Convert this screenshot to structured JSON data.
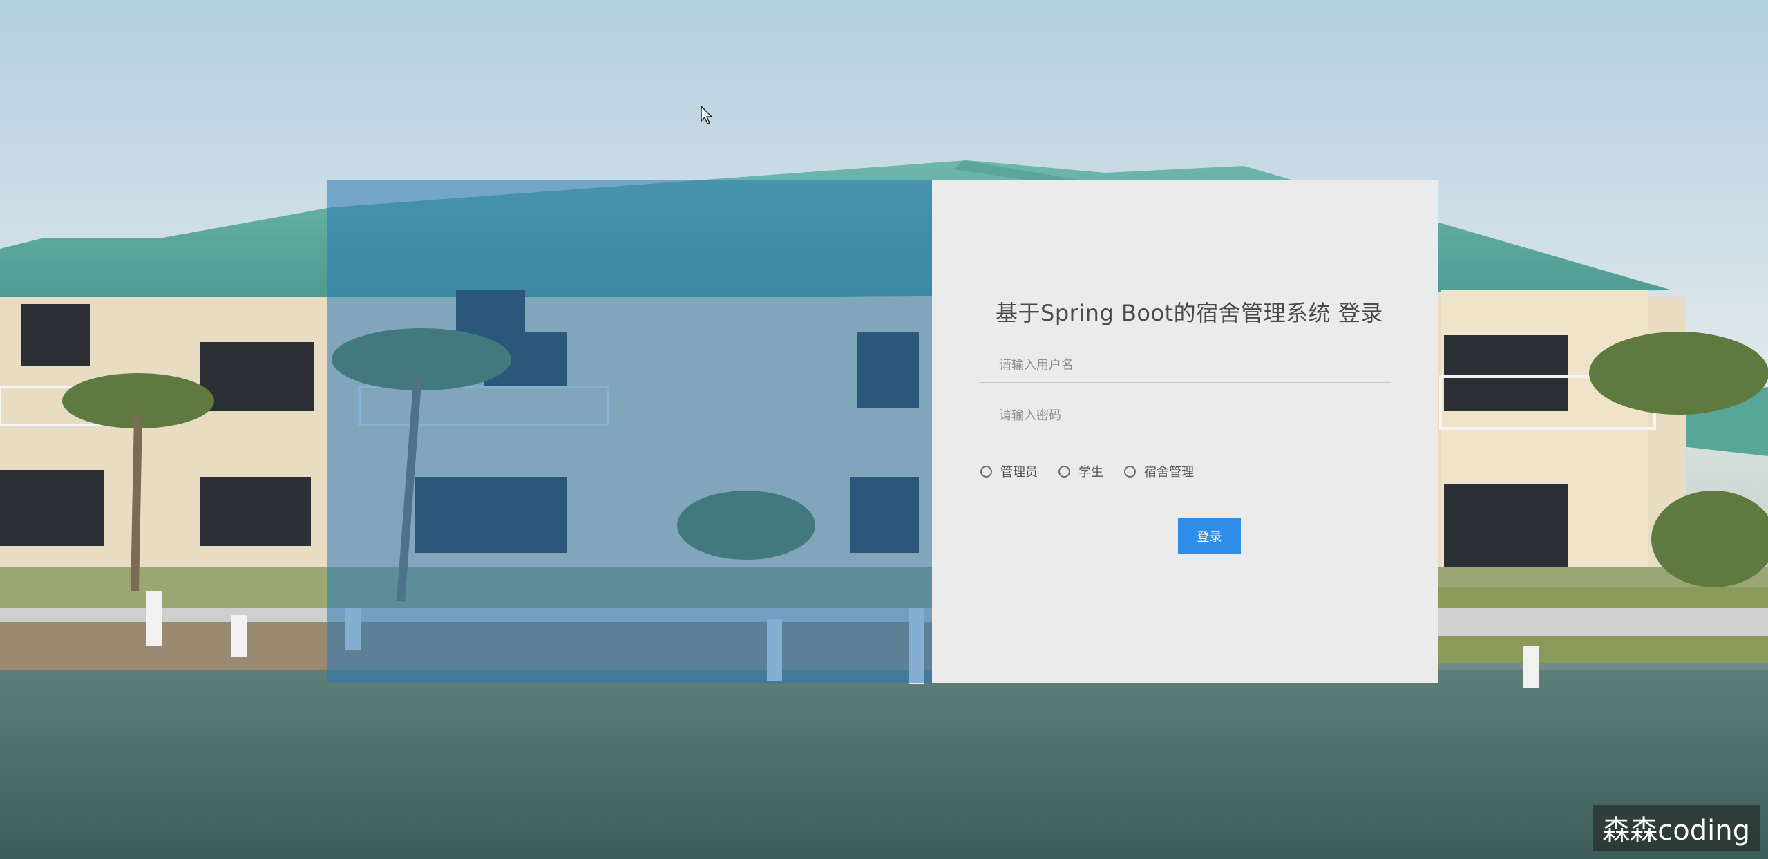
{
  "login": {
    "title": "基于Spring Boot的宿舍管理系统 登录",
    "username_placeholder": "请输入用户名",
    "password_placeholder": "请输入密码",
    "roles": [
      "管理员",
      "学生",
      "宿舍管理"
    ],
    "submit_label": "登录"
  },
  "watermark": "森森coding",
  "colors": {
    "accent": "#2e8de8",
    "card_background": "#ebebeb",
    "overlay": "#2c78b4"
  }
}
